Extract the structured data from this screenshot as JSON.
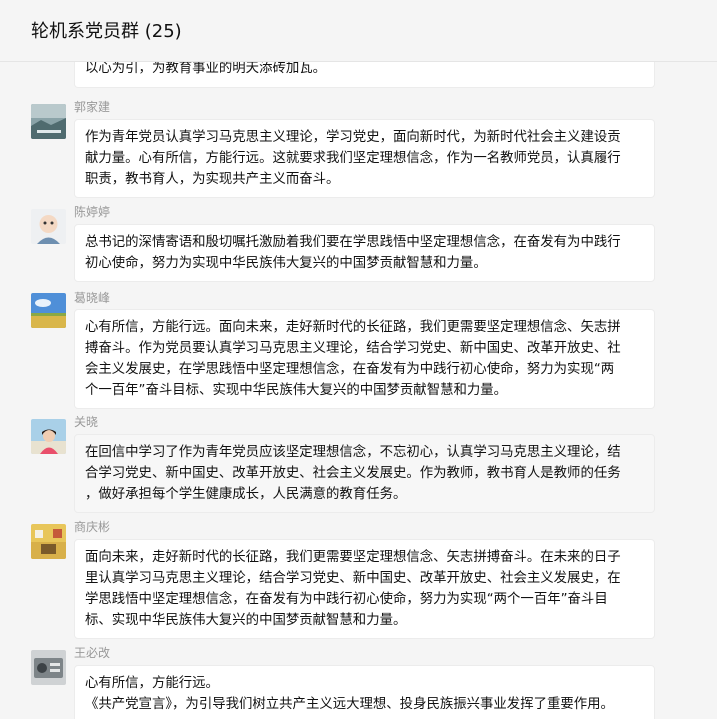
{
  "chat": {
    "title": "轮机系党员群 (25)",
    "messages": [
      {
        "sender": "",
        "avatar_icon": "",
        "lines": [
          "以心为引，为教育事业的明天添砖加瓦。"
        ]
      },
      {
        "sender": "郭家建",
        "avatar_icon": "landscape-photo-avatar-icon",
        "lines": [
          "作为青年党员认真学习马克思主义理论，学习党史，面向新时代，为新时代社会主义建设贡",
          "献力量。心有所信，方能行远。这就要求我们坚定理想信念，作为一名教师党员，认真履行",
          "职责，教书育人，为实现共产主义而奋斗。"
        ]
      },
      {
        "sender": "陈婷婷",
        "avatar_icon": "cartoon-avatar-icon",
        "lines": [
          "总书记的深情寄语和殷切嘱托激励着我们要在学思践悟中坚定理想信念，在奋发有为中践行",
          "初心使命，努力为实现中华民族伟大复兴的中国梦贡献智慧和力量。"
        ]
      },
      {
        "sender": "葛晓峰",
        "avatar_icon": "sky-field-avatar-icon",
        "lines": [
          "心有所信，方能行远。面向未来，走好新时代的长征路，我们更需要坚定理想信念、矢志拼",
          "搏奋斗。作为党员要认真学习马克思主义理论，结合学习党史、新中国史、改革开放史、社",
          "会主义发展史，在学思践悟中坚定理想信念，在奋发有为中践行初心使命，努力为实现“两",
          "个一百年”奋斗目标、实现中华民族伟大复兴的中国梦贡献智慧和力量。"
        ]
      },
      {
        "sender": "关晓",
        "avatar_icon": "person-photo-avatar-icon",
        "lines": [
          "在回信中学习了作为青年党员应该坚定理想信念，不忘初心，认真学习马克思主义理论，结",
          "合学习党史、新中国史、改革开放史、社会主义发展史。作为教师，教书育人是教师的任务",
          "，做好承担每个学生健康成长，人民满意的教育任务。"
        ]
      },
      {
        "sender": "商庆彬",
        "avatar_icon": "room-photo-avatar-icon",
        "lines": [
          "面向未来，走好新时代的长征路，我们更需要坚定理想信念、矢志拼搏奋斗。在未来的日子",
          "里认真学习马克思主义理论，结合学习党史、新中国史、改革开放史、社会主义发展史，在",
          "学思践悟中坚定理想信念，在奋发有为中践行初心使命，努力为实现“两个一百年”奋斗目",
          "标、实现中华民族伟大复兴的中国梦贡献智慧和力量。"
        ]
      },
      {
        "sender": "王必改",
        "avatar_icon": "device-photo-avatar-icon",
        "lines": [
          "心有所信，方能行远。",
          "《共产党宣言》，为引导我们树立共产主义远大理想、投身民族振兴事业发挥了重要作用。"
        ]
      }
    ]
  }
}
